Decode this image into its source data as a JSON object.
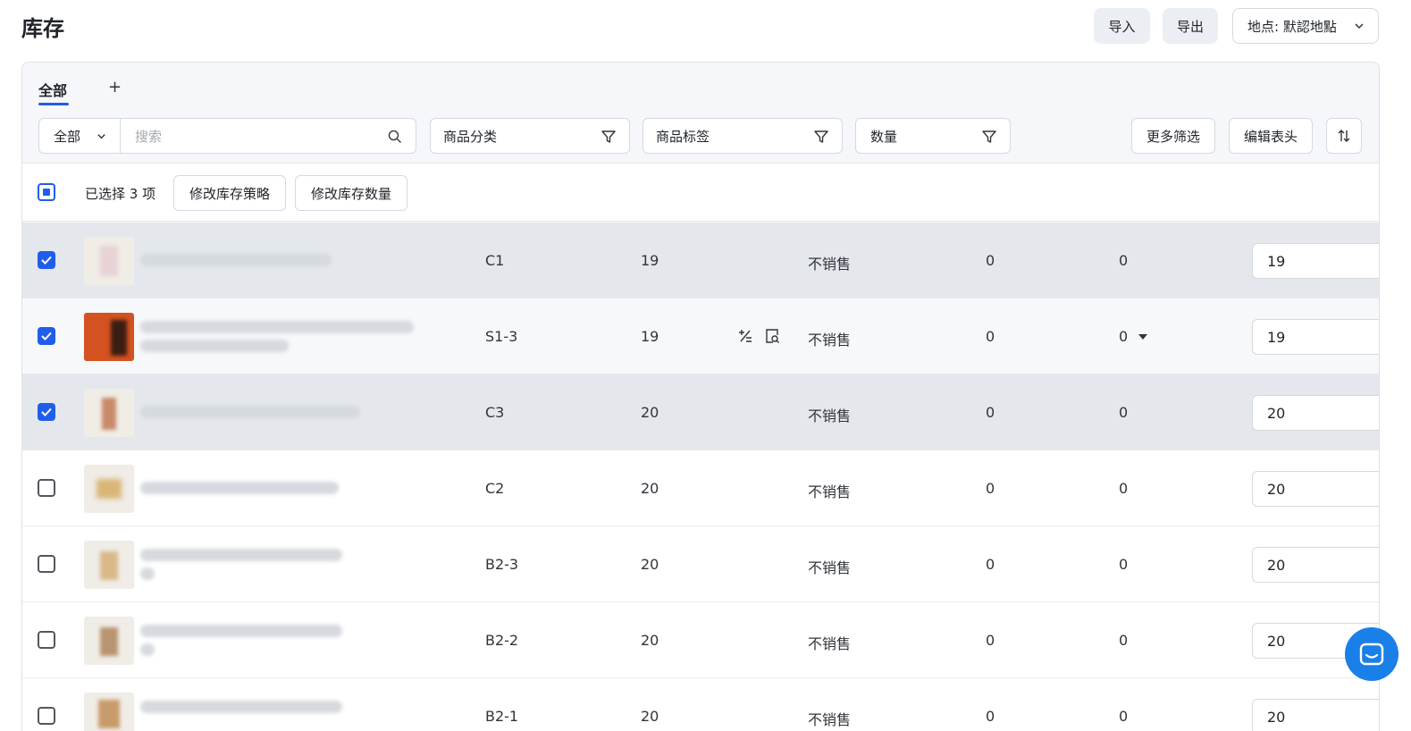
{
  "header": {
    "title": "库存",
    "import_label": "导入",
    "export_label": "导出",
    "location_label": "地点: 默認地點"
  },
  "tabs": {
    "all_label": "全部",
    "add_label": "+"
  },
  "filters": {
    "scope_label": "全部",
    "search_placeholder": "搜索",
    "category_label": "商品分类",
    "tags_label": "商品标签",
    "quantity_label": "数量",
    "more_label": "更多筛选",
    "edit_columns_label": "编辑表头"
  },
  "selection": {
    "count_text": "已选择 3 项",
    "edit_policy_label": "修改库存策略",
    "edit_quantity_label": "修改库存数量"
  },
  "rows": [
    {
      "sku": "C1",
      "qty": "19",
      "policy": "不销售",
      "col_a": "0",
      "col_b": "0",
      "input": "19",
      "checked": true
    },
    {
      "sku": "S1-3",
      "qty": "19",
      "policy": "不销售",
      "col_a": "0",
      "col_b": "0",
      "input": "19",
      "checked": true
    },
    {
      "sku": "C3",
      "qty": "20",
      "policy": "不销售",
      "col_a": "0",
      "col_b": "0",
      "input": "20",
      "checked": true
    },
    {
      "sku": "C2",
      "qty": "20",
      "policy": "不销售",
      "col_a": "0",
      "col_b": "0",
      "input": "20",
      "checked": false
    },
    {
      "sku": "B2-3",
      "qty": "20",
      "policy": "不销售",
      "col_a": "0",
      "col_b": "0",
      "input": "20",
      "checked": false
    },
    {
      "sku": "B2-2",
      "qty": "20",
      "policy": "不销售",
      "col_a": "0",
      "col_b": "0",
      "input": "20",
      "checked": false
    },
    {
      "sku": "B2-1",
      "qty": "20",
      "policy": "不销售",
      "col_a": "0",
      "col_b": "0",
      "input": "20",
      "checked": false
    }
  ],
  "icons": {
    "search": "search-icon",
    "filter": "filter-icon",
    "sort": "sort-icon",
    "chevron": "chevron-down-icon",
    "adjust": "plus-minus-icon",
    "history": "search-document-icon",
    "dropdown": "caret-down-icon",
    "chat": "chat-icon"
  },
  "colors": {
    "accent": "#1f5eea",
    "selected_row": "#e4e8ed",
    "chat_bubble": "#1a7fe8"
  }
}
